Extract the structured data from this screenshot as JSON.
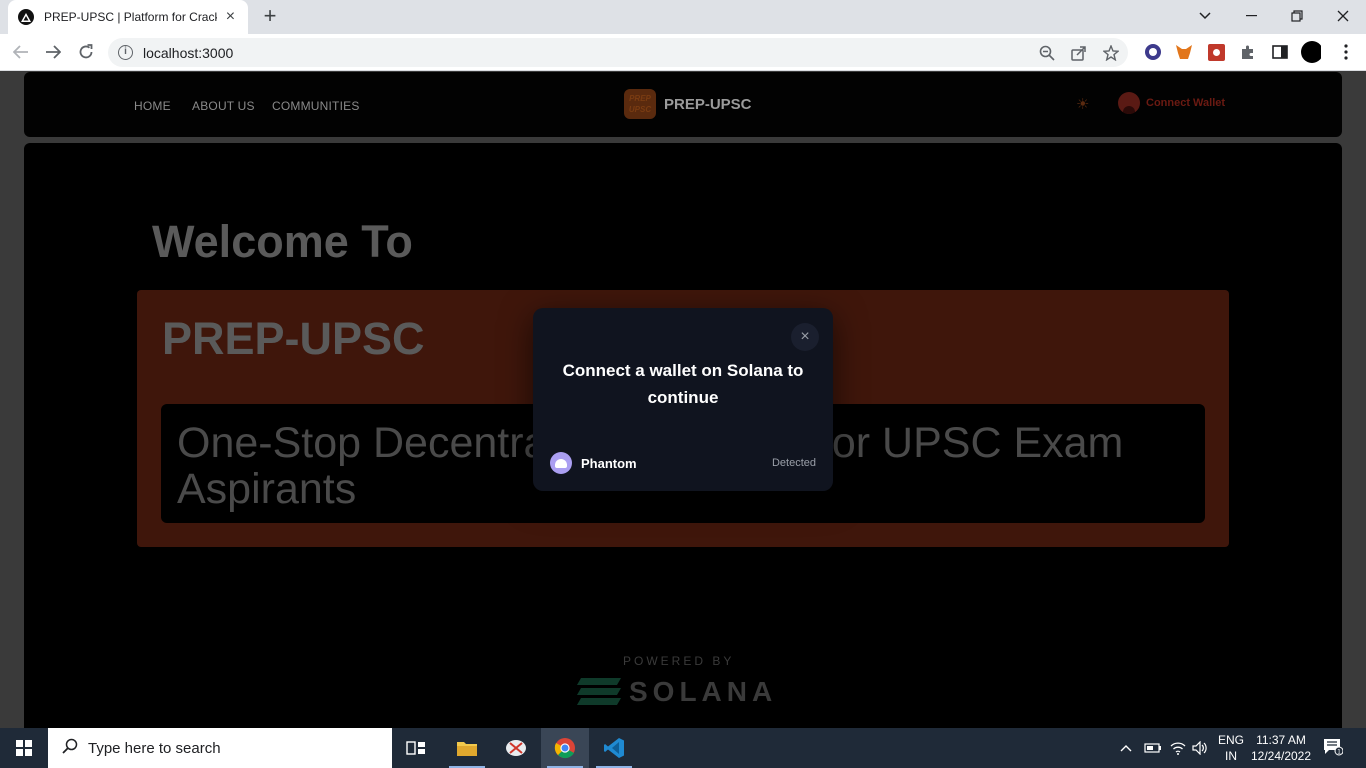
{
  "browser": {
    "tab_title": "PREP-UPSC | Platform for Cracking UPSC",
    "tab_close": "×",
    "new_tab": "+",
    "url": "localhost:3000",
    "info_glyph": "i"
  },
  "site": {
    "nav": {
      "home": "HOME",
      "about": "ABOUT US",
      "communities": "COMMUNITIES"
    },
    "brand": {
      "logo_text": "PREP UPSC",
      "name": "PREP-UPSC"
    },
    "connect_wallet": "Connect Wallet",
    "welcome": "Welcome To",
    "panel_title": "PREP-UPSC",
    "tagline": "One-Stop Decentralized Platform for UPSC Exam Aspirants",
    "powered_by": "POWERED BY",
    "solana_word": "SOLANA"
  },
  "modal": {
    "title": "Connect a wallet on Solana to continue",
    "close": "×",
    "wallets": [
      {
        "name": "Phantom",
        "status": "Detected"
      }
    ]
  },
  "taskbar": {
    "search_placeholder": "Type here to search",
    "lang_top": "ENG",
    "lang_bottom": "IN",
    "time": "11:37 AM",
    "date": "12/24/2022",
    "notification_count": "1"
  },
  "colors": {
    "modal_bg": "#10141f",
    "panel_bg": "#3f160b",
    "connect_wallet": "#6b1a12",
    "phantom": "#ab9ff2",
    "taskbar": "#1f2a38"
  }
}
